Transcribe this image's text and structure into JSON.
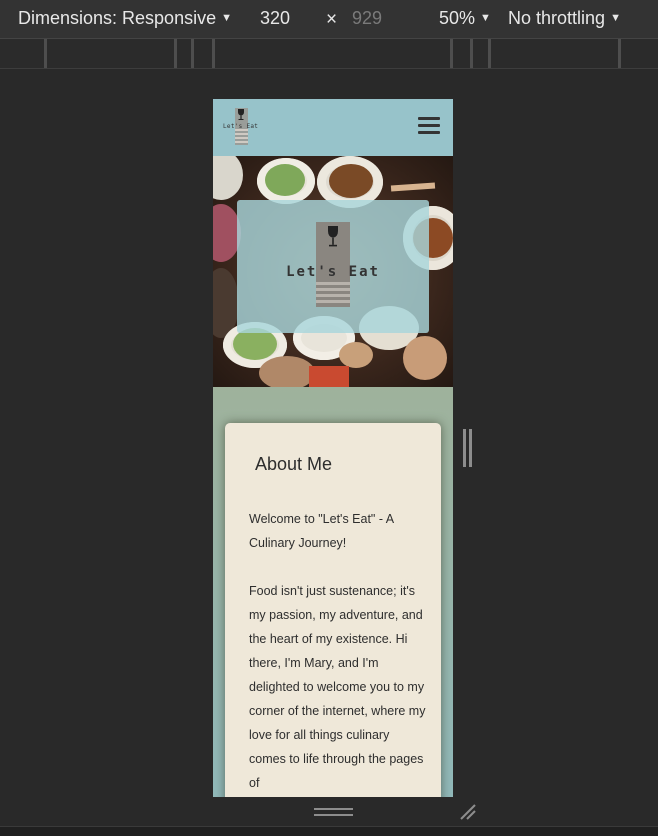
{
  "toolbar": {
    "dimensions_label": "Dimensions: Responsive",
    "width": "320",
    "times": "×",
    "height": "929",
    "zoom": "50%",
    "throttling": "No throttling"
  },
  "site": {
    "logo_text": "Let's Eat",
    "menu_icon": "hamburger-menu-icon"
  },
  "hero": {
    "logo_text": "Let's Eat"
  },
  "about": {
    "title": "About Me",
    "paragraph1": "Welcome to \"Let's Eat\" - A Culinary Journey!",
    "paragraph2": "Food isn't just sustenance; it's my passion, my adventure, and the heart of my existence. Hi there, I'm Mary, and I'm delighted to welcome you to my corner of the internet, where my love for all things culinary comes to life through the pages of"
  },
  "colors": {
    "header_bg": "#97c3ca",
    "card_bg": "#efe8d9",
    "hero_card_bg": "#a8d6da",
    "devtools_bg": "#292929"
  }
}
